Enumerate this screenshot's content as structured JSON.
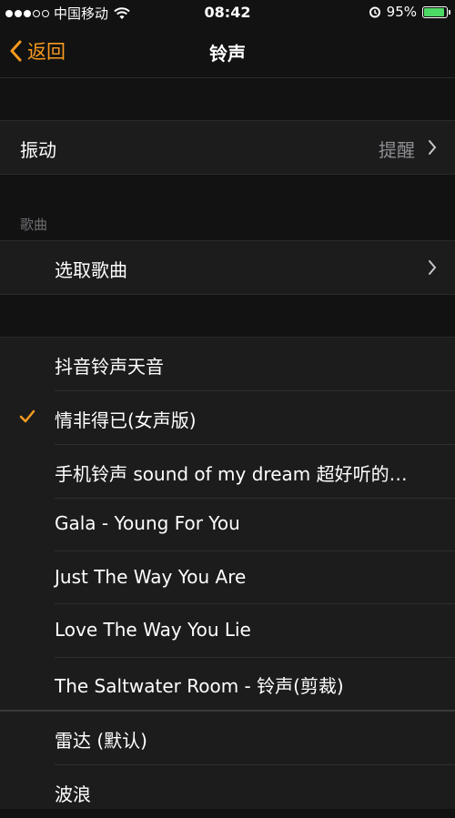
{
  "status": {
    "carrier": "中国移动",
    "time": "08:42",
    "battery": "95%",
    "battery_level": 0.95
  },
  "nav": {
    "back_label": "返回",
    "title": "铃声"
  },
  "vibration": {
    "label": "振动",
    "value": "提醒"
  },
  "songs_section": {
    "header": "歌曲",
    "pick_label": "选取歌曲"
  },
  "ringtones": [
    {
      "label": "抖音铃声天音",
      "selected": false
    },
    {
      "label": "情非得已(女声版)",
      "selected": true
    },
    {
      "label": "手机铃声 sound of my dream 超好听的…",
      "selected": false
    },
    {
      "label": "Gala - Young For You",
      "selected": false
    },
    {
      "label": "Just The Way You Are",
      "selected": false
    },
    {
      "label": "Love The Way You Lie",
      "selected": false
    },
    {
      "label": "The Saltwater Room - 铃声(剪裁)",
      "selected": false
    }
  ],
  "system_tones": [
    {
      "label": "雷达 (默认)"
    },
    {
      "label": "波浪"
    }
  ],
  "colors": {
    "accent": "#f79a20",
    "background": "#121212",
    "cell": "#1c1c1c"
  }
}
